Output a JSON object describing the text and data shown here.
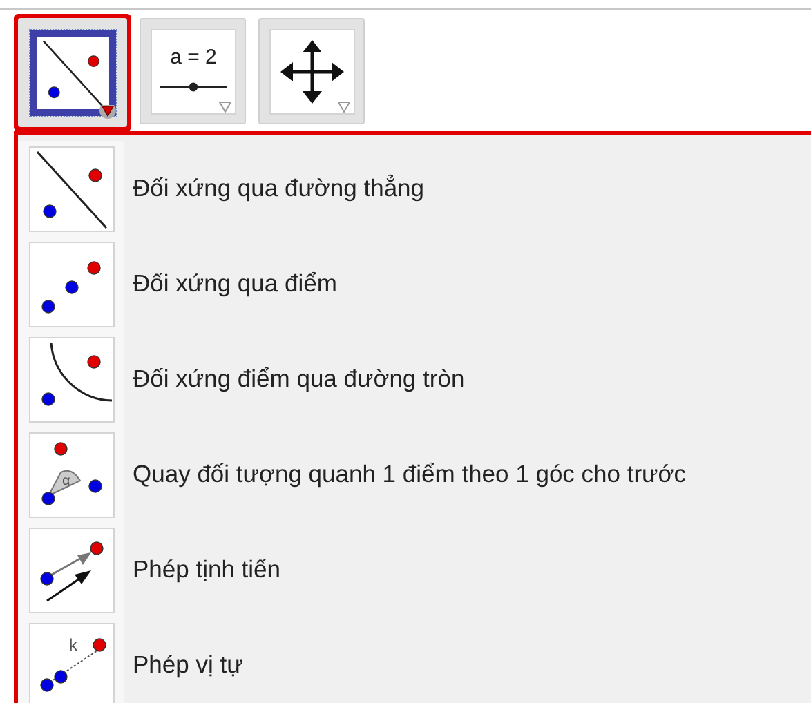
{
  "toolbar": [
    {
      "kind": "reflect-line",
      "selected": true
    },
    {
      "kind": "slider",
      "selected": false,
      "icon_text": "a = 2"
    },
    {
      "kind": "move",
      "selected": false
    }
  ],
  "menu": {
    "items": [
      {
        "kind": "reflect-line",
        "label": "Đối xứng qua đường thẳng"
      },
      {
        "kind": "reflect-point",
        "label": "Đối xứng qua điểm"
      },
      {
        "kind": "reflect-circle",
        "label": "Đối xứng điểm qua đường tròn"
      },
      {
        "kind": "rotate",
        "label": "Quay đối tượng quanh 1 điểm theo 1 góc cho trước",
        "icon_text": "α"
      },
      {
        "kind": "translate",
        "label": "Phép tịnh tiến"
      },
      {
        "kind": "dilate",
        "label": "Phép vị tự",
        "icon_text": "k"
      }
    ]
  }
}
